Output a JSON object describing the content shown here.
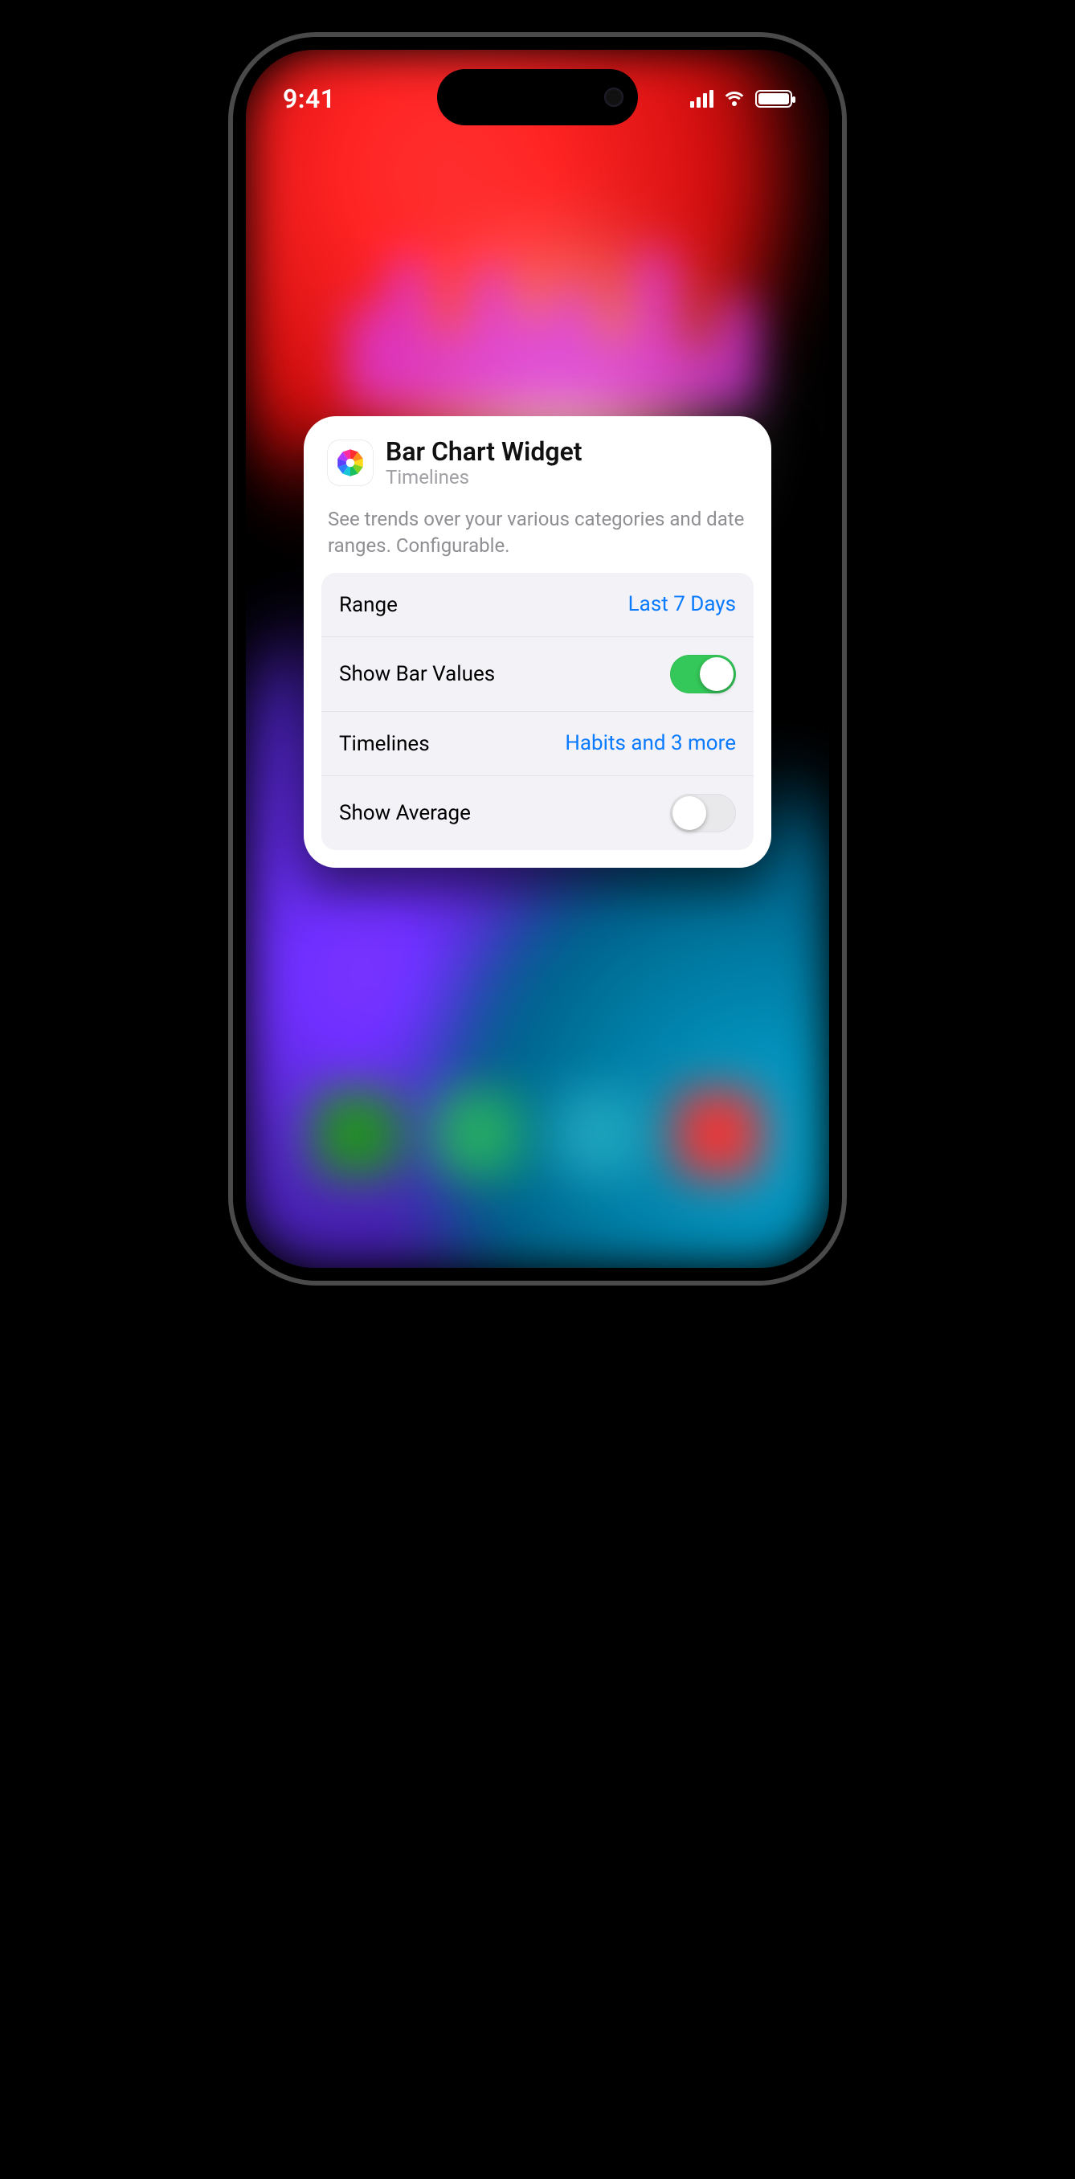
{
  "statusbar": {
    "time": "9:41"
  },
  "card": {
    "title": "Bar Chart Widget",
    "subtitle": "Timelines",
    "description": "See trends over your various categories and date ranges. Configurable."
  },
  "settings": {
    "range": {
      "label": "Range",
      "value": "Last 7 Days"
    },
    "showValues": {
      "label": "Show Bar Values",
      "on": true
    },
    "timelines": {
      "label": "Timelines",
      "value": "Habits and 3 more"
    },
    "showAverage": {
      "label": "Show Average",
      "on": false
    }
  }
}
